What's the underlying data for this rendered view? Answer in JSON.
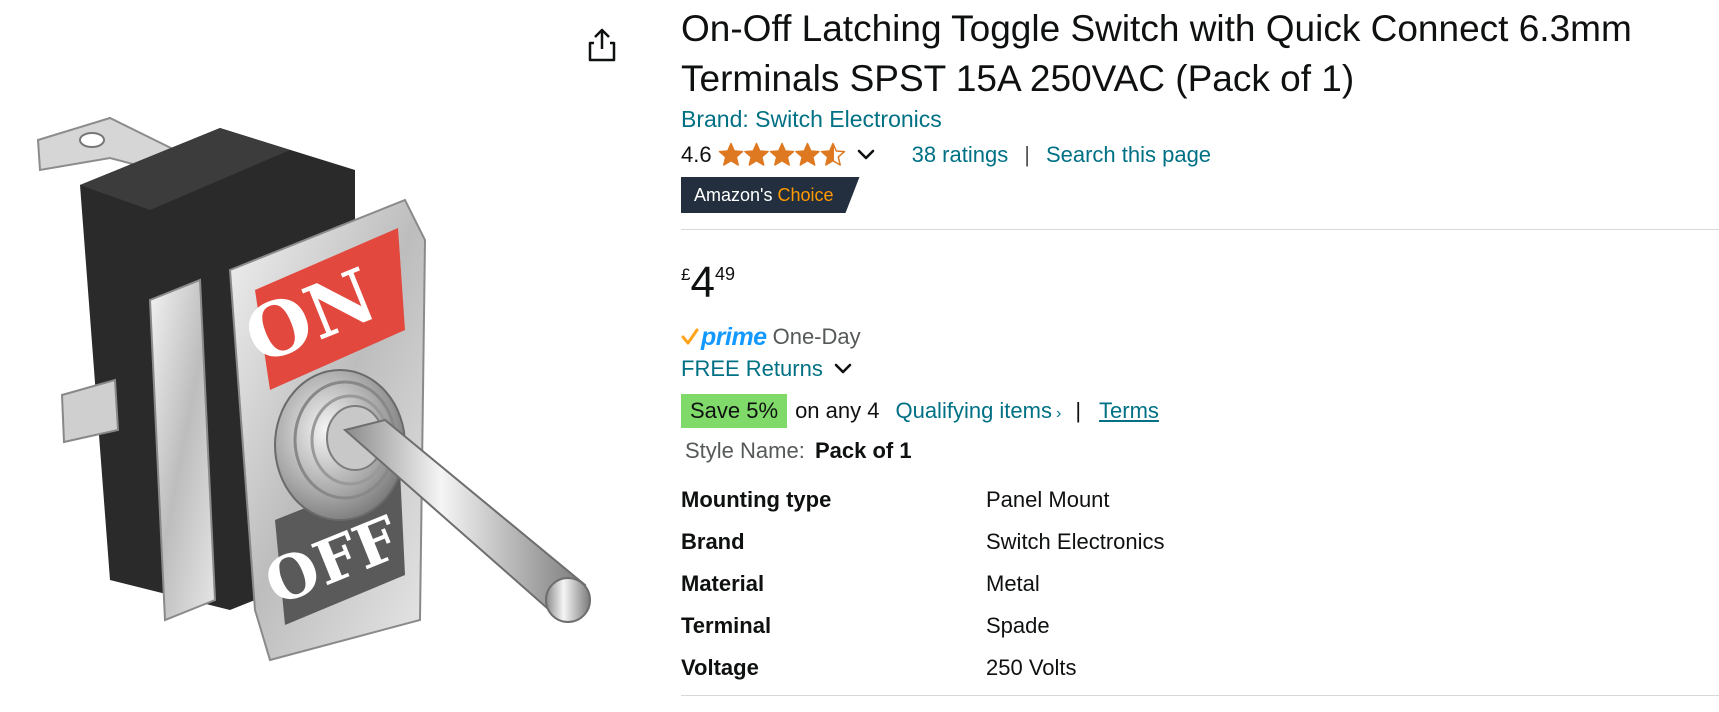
{
  "product": {
    "title": "On-Off Latching Toggle Switch with Quick Connect 6.3mm Terminals SPST 15A 250VAC (Pack of 1)",
    "brand_link": "Brand: Switch Electronics",
    "image_label_on": "ON",
    "image_label_off": "OFF"
  },
  "rating": {
    "value": "4.6",
    "stars": 4.6,
    "ratings_link": "38 ratings",
    "separator": "|",
    "search_link": "Search this page"
  },
  "badge": {
    "prefix": "Amazon's",
    "choice": "Choice"
  },
  "price": {
    "currency": "£",
    "whole": "4",
    "fraction": "49"
  },
  "delivery": {
    "prime": "prime",
    "one_day": "One-Day",
    "returns": "FREE Returns"
  },
  "promo": {
    "save": "Save 5%",
    "text": "on any 4",
    "qualifying": "Qualifying items",
    "arrow": "›",
    "separator": "|",
    "terms": "Terms"
  },
  "style": {
    "label": "Style Name:",
    "value": "Pack of 1"
  },
  "specs": [
    {
      "key": "Mounting type",
      "value": "Panel Mount"
    },
    {
      "key": "Brand",
      "value": "Switch Electronics"
    },
    {
      "key": "Material",
      "value": "Metal"
    },
    {
      "key": "Terminal",
      "value": "Spade"
    },
    {
      "key": "Voltage",
      "value": "250 Volts"
    }
  ],
  "colors": {
    "link": "#007185",
    "star": "#de7921",
    "badge_bg": "#232f3e",
    "badge_choice": "#ff9900",
    "prime_blue": "#1399ff",
    "prime_check": "#ffa41c",
    "save_green": "#7fda69"
  },
  "icons": [
    "share-icon",
    "star-icon",
    "chevron-down-icon",
    "prime-check-icon"
  ]
}
